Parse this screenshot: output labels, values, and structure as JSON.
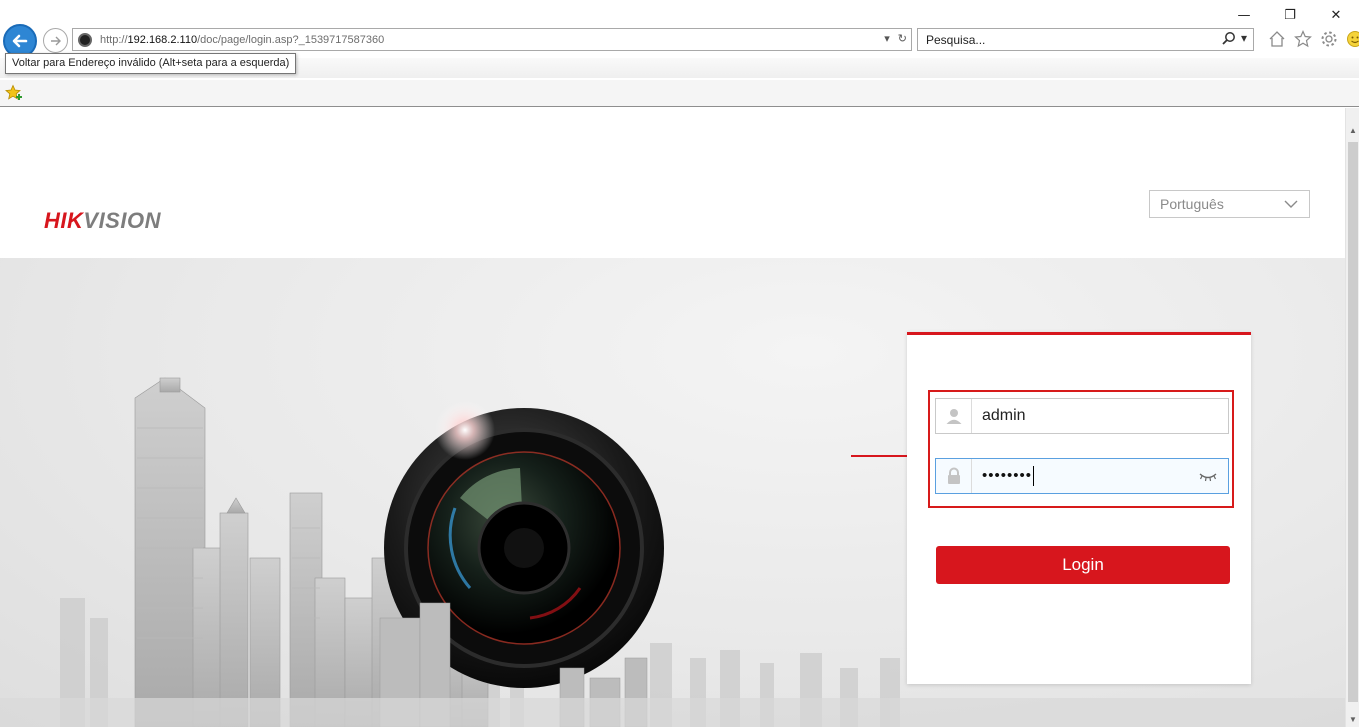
{
  "browser": {
    "back_tooltip": "Voltar para Endereço inválido (Alt+seta para a esquerda)",
    "url_prefix": "http://",
    "url_host": "192.168.2.110",
    "url_path": "/doc/page/login.asp?_1539717587360",
    "search_placeholder": "Pesquisa...",
    "window_controls": {
      "minimize": "—",
      "restore": "❐",
      "close": "✕"
    },
    "icons": [
      "home-icon",
      "favorites-star-icon",
      "settings-gear-icon",
      "smiley-feedback-icon"
    ]
  },
  "page": {
    "logo": {
      "part1": "HIK",
      "part2": "VISION",
      "color_red": "#d7161d",
      "color_gray": "#7d7d7d"
    },
    "language_select": {
      "selected": "Português"
    },
    "login": {
      "username": "admin",
      "password_masked": "••••••••",
      "login_button": "Login",
      "accent_color": "#d7161d"
    }
  }
}
